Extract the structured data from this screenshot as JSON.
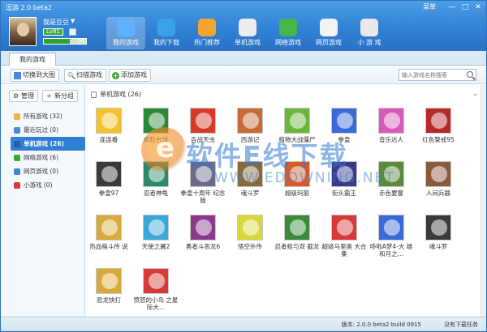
{
  "window": {
    "title": "逗游 2.0 beta2",
    "menu_label": "菜单",
    "minimize": "—",
    "maximize": "□",
    "close": "✕"
  },
  "user": {
    "name": "我是豆豆",
    "level": "Lv81",
    "exp_value": "98",
    "exp_fraction": 0.62
  },
  "nav": [
    {
      "label": "我的游戏",
      "icon": "person-icon",
      "color": "#5fb0ff",
      "active": true
    },
    {
      "label": "我的下载",
      "icon": "gear-icon",
      "color": "#3aa0e8",
      "active": false
    },
    {
      "label": "热门推荐",
      "icon": "plus-icon",
      "color": "#f3a530",
      "active": false
    },
    {
      "label": "单机游戏",
      "icon": "gamepad-icon",
      "color": "#ececec",
      "active": false
    },
    {
      "label": "网络游戏",
      "icon": "network-game-icon",
      "color": "#49b449",
      "active": false
    },
    {
      "label": "网页游戏",
      "icon": "web-game-icon",
      "color": "#f2f2f2",
      "active": false
    },
    {
      "label": "小 游 戏",
      "icon": "joystick-icon",
      "color": "#e9e9e9",
      "active": false
    }
  ],
  "tabs": [
    {
      "label": "我的游戏"
    }
  ],
  "toolbar": {
    "switch_view": "切换到大图",
    "scan": "扫描游戏",
    "add": "添加游戏",
    "search_placeholder": "输入游戏名称搜索"
  },
  "sidebar": {
    "manage": "管理",
    "new_group": "新分组",
    "categories": [
      {
        "label": "所有游戏 (32)",
        "icon": "folder-icon",
        "color": "#e8b64a",
        "active": false
      },
      {
        "label": "最近玩过 (0)",
        "icon": "clock-icon",
        "color": "#4a8ad8",
        "active": false
      },
      {
        "label": "单机游戏 (26)",
        "icon": "pc-game-icon",
        "color": "#2a5aa8",
        "active": true
      },
      {
        "label": "网络游戏 (6)",
        "icon": "globe-icon",
        "color": "#38a838",
        "active": false
      },
      {
        "label": "网页游戏 (0)",
        "icon": "web-icon",
        "color": "#3a8ad8",
        "active": false
      },
      {
        "label": "小游戏 (0)",
        "icon": "joystick-icon",
        "color": "#d83a3a",
        "active": false
      }
    ]
  },
  "main": {
    "section_title": "单机游戏 (26)",
    "collapse": "⌄",
    "games": [
      {
        "label": "连连看",
        "color": "#f2c230"
      },
      {
        "label": "疯狂台球",
        "color": "#2a8a3a"
      },
      {
        "label": "百战天虫",
        "color": "#d83a2a"
      },
      {
        "label": "西游记",
        "color": "#c86a3a"
      },
      {
        "label": "植物大战僵尸",
        "color": "#6ab63a"
      },
      {
        "label": "拳皇",
        "color": "#3a6ad8"
      },
      {
        "label": "音乐达人",
        "color": "#d85ab8"
      },
      {
        "label": "红色警戒95",
        "color": "#b82a2a"
      },
      {
        "label": "拳皇97",
        "color": "#3a3a3a"
      },
      {
        "label": "忍者神龟",
        "color": "#2a8a6a"
      },
      {
        "label": "拳皇十周年 纪念版",
        "color": "#6a6a8a"
      },
      {
        "label": "魂斗罗",
        "color": "#8a6a3a"
      },
      {
        "label": "超级玛丽",
        "color": "#d85a2a"
      },
      {
        "label": "街头霸王",
        "color": "#3a3a8a"
      },
      {
        "label": "赤色要塞",
        "color": "#5a8a3a"
      },
      {
        "label": "人间兵器",
        "color": "#8a5a3a"
      },
      {
        "label": "热血格斗传 说",
        "color": "#d8aa3a"
      },
      {
        "label": "天使之翼2",
        "color": "#3aa8d8"
      },
      {
        "label": "勇者斗恶龙6",
        "color": "#8a3a8a"
      },
      {
        "label": "悟空外传",
        "color": "#d8d83a"
      },
      {
        "label": "忍者蛙与双 截龙",
        "color": "#3a8a3a"
      },
      {
        "label": "超级马里奥 大合集",
        "color": "#d83a3a"
      },
      {
        "label": "哆啦A梦4-大 雄和月之...",
        "color": "#3a6ad8"
      },
      {
        "label": "魂斗罗",
        "color": "#3a3a3a"
      },
      {
        "label": "恐龙快打",
        "color": "#d8a83a"
      },
      {
        "label": "愤怒的小鸟 之星际大...",
        "color": "#d83a3a"
      }
    ]
  },
  "watermark": {
    "text": "软件E线下载",
    "url": "WWW.EDOWNING.NET"
  },
  "status": {
    "version": "版本: 2.0.0 beta2 build 0915",
    "task": "没有下载任务"
  }
}
